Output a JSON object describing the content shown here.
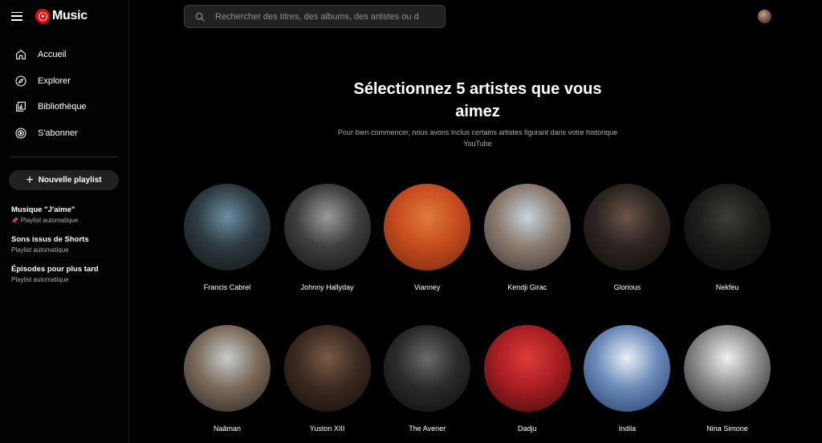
{
  "app": {
    "logo_text": "Music"
  },
  "nav": [
    {
      "label": "Accueil",
      "icon": "home-icon"
    },
    {
      "label": "Explorer",
      "icon": "compass-icon"
    },
    {
      "label": "Bibliothèque",
      "icon": "library-icon"
    },
    {
      "label": "S'abonner",
      "icon": "subscribe-icon"
    }
  ],
  "new_playlist_label": "Nouvelle playlist",
  "playlists": [
    {
      "title": "Musique \"J'aime\"",
      "subtitle": "Playlist automatique",
      "pinned": true
    },
    {
      "title": "Sons issus de Shorts",
      "subtitle": "Playlist automatique"
    },
    {
      "title": "Épisodes pour plus tard",
      "subtitle": "Playlist automatique"
    }
  ],
  "search": {
    "placeholder": "Rechercher des titres, des albums, des artistes ou d"
  },
  "main": {
    "heading": "Sélectionnez 5 artistes que vous aimez",
    "subtitle": "Pour bien commencer, nous avons inclus certains artistes figurant dans votre historique YouTube"
  },
  "artists": [
    {
      "name": "Francis Cabrel",
      "colors": [
        "#6c8da3",
        "#2d3a40",
        "#0e1112"
      ]
    },
    {
      "name": "Johnny Hallyday",
      "colors": [
        "#9a9a9a",
        "#3e3e3e",
        "#111111"
      ]
    },
    {
      "name": "Vianney",
      "colors": [
        "#e07a3a",
        "#c64b1e",
        "#6a2a10"
      ]
    },
    {
      "name": "Kendji Girac",
      "colors": [
        "#c7d4de",
        "#8a7a6e",
        "#3a3430"
      ]
    },
    {
      "name": "Glorious",
      "colors": [
        "#6a5548",
        "#2c2420",
        "#0f0c0a"
      ]
    },
    {
      "name": "Nekfeu",
      "colors": [
        "#3b3d36",
        "#1c1d1a",
        "#070707"
      ]
    },
    {
      "name": "Naâman",
      "colors": [
        "#c7cccd",
        "#7a6a5a",
        "#2a2220"
      ]
    },
    {
      "name": "Yuston XIII",
      "colors": [
        "#7a5a44",
        "#3a2a20",
        "#120d0a"
      ]
    },
    {
      "name": "The Avener",
      "colors": [
        "#6a6a6a",
        "#2a2a2a",
        "#0b0b0b"
      ]
    },
    {
      "name": "Dadju",
      "colors": [
        "#e03a3a",
        "#a81e22",
        "#3a0a0a"
      ]
    },
    {
      "name": "Indila",
      "colors": [
        "#eaf0f8",
        "#6a8ab8",
        "#203a6a"
      ]
    },
    {
      "name": "Nina Simone",
      "colors": [
        "#f0f0f0",
        "#8a8a8a",
        "#1a1a1a"
      ]
    }
  ]
}
